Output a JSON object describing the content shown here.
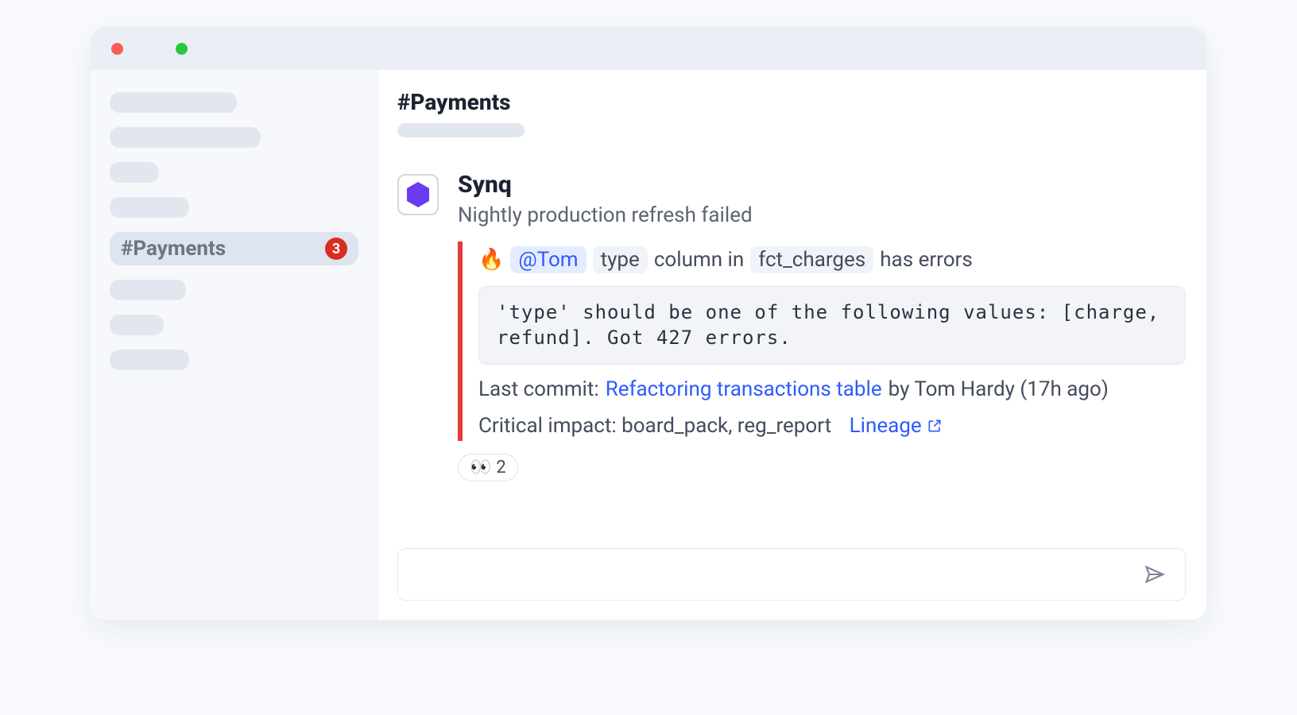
{
  "titlebar": {
    "controls": [
      "close",
      "minimize"
    ]
  },
  "sidebar": {
    "active_channel_label": "#Payments",
    "active_channel_badge": "3"
  },
  "channel": {
    "title": "#Payments"
  },
  "message": {
    "author": "Synq",
    "subject": "Nightly production refresh failed",
    "alert": {
      "emoji": "🔥",
      "mention": "@Tom",
      "chip_type": "type",
      "text_column_in": "column in",
      "chip_table": "fct_charges",
      "text_has_errors": "has errors"
    },
    "code": "'type' should be one of the following values: [charge, refund]. Got 427 errors.",
    "last_commit": {
      "label": "Last commit:",
      "link_text": "Refactoring transactions table",
      "by_text": "by Tom Hardy (17h ago)"
    },
    "impact": {
      "label": "Critical impact: board_pack, reg_report",
      "lineage_label": "Lineage"
    },
    "reaction": {
      "emoji": "👀",
      "count": "2"
    }
  },
  "composer": {
    "placeholder": ""
  }
}
